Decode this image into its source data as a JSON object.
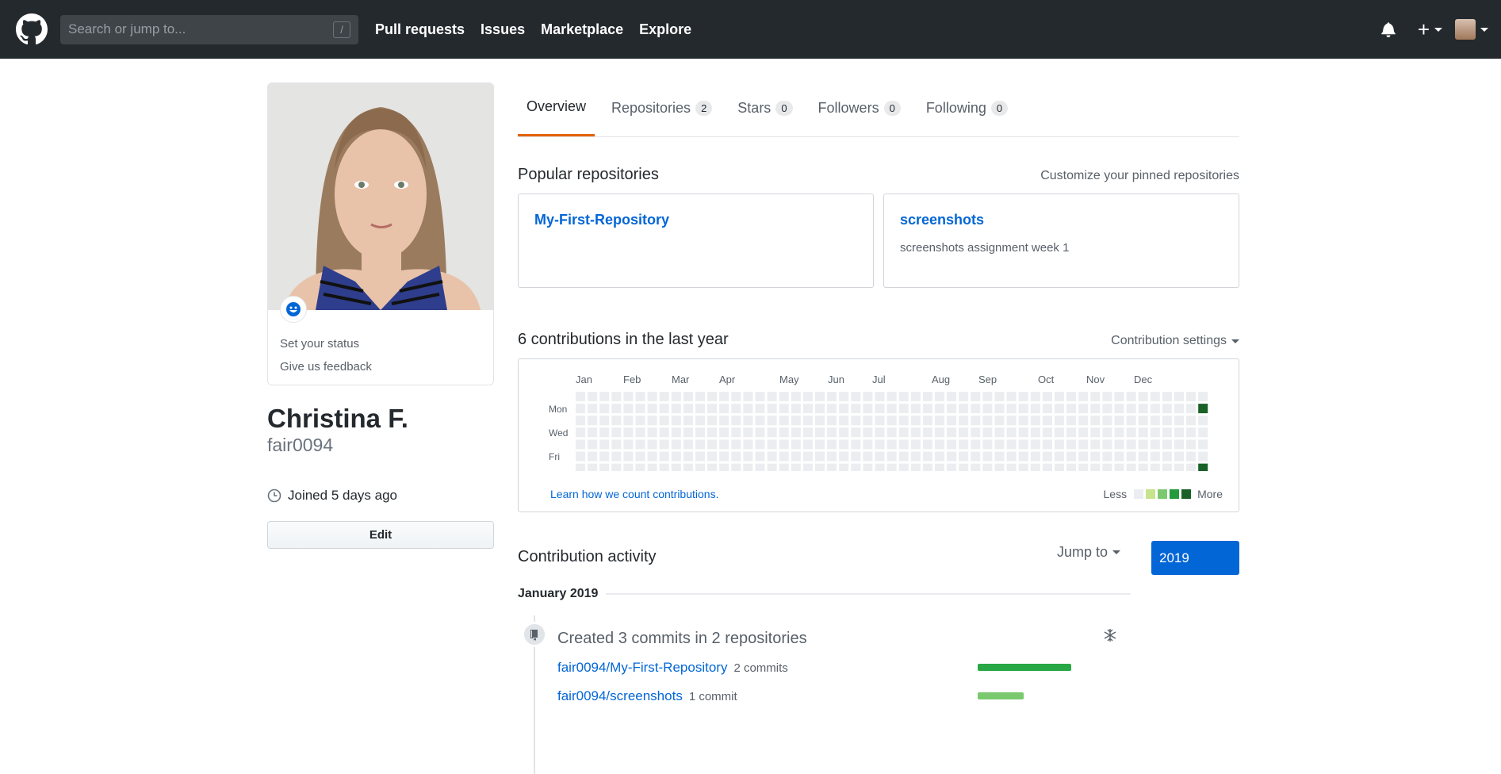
{
  "header": {
    "search_placeholder": "Search or jump to...",
    "search_shortcut": "/",
    "nav": [
      "Pull requests",
      "Issues",
      "Marketplace",
      "Explore"
    ],
    "plus": "+"
  },
  "profile": {
    "status_links": [
      "Set your status",
      "Give us feedback"
    ],
    "fullname": "Christina F.",
    "username": "fair0094",
    "joined": "Joined 5 days ago",
    "edit_label": "Edit"
  },
  "tabs": [
    {
      "label": "Overview",
      "count": null
    },
    {
      "label": "Repositories",
      "count": "2"
    },
    {
      "label": "Stars",
      "count": "0"
    },
    {
      "label": "Followers",
      "count": "0"
    },
    {
      "label": "Following",
      "count": "0"
    }
  ],
  "popular": {
    "title": "Popular repositories",
    "customize": "Customize your pinned repositories",
    "repos": [
      {
        "name": "My-First-Repository",
        "desc": ""
      },
      {
        "name": "screenshots",
        "desc": "screenshots assignment week 1"
      }
    ]
  },
  "contributions": {
    "title": "6 contributions in the last year",
    "settings": "Contribution settings",
    "months": [
      "Jan",
      "Feb",
      "Mar",
      "Apr",
      "May",
      "Jun",
      "Jul",
      "Aug",
      "Sep",
      "Oct",
      "Nov",
      "Dec"
    ],
    "days": [
      "Mon",
      "Wed",
      "Fri"
    ],
    "learn": "Learn how we count contributions.",
    "less": "Less",
    "more": "More",
    "active_cells": [
      {
        "week": 52,
        "day": 1,
        "level": 4
      },
      {
        "week": 52,
        "day": 6,
        "level": 4
      }
    ],
    "colors": [
      "#ebedf0",
      "#c6e48b",
      "#7bc96f",
      "#239a3b",
      "#196127"
    ]
  },
  "activity": {
    "title": "Contribution activity",
    "jump": "Jump to",
    "year": "2019",
    "month": "January 2019",
    "event_title": "Created 3 commits in 2 repositories",
    "repos": [
      {
        "name": "fair0094/My-First-Repository",
        "commits": "2 commits",
        "share": 0.67
      },
      {
        "name": "fair0094/screenshots",
        "commits": "1 commit",
        "share": 0.33
      }
    ]
  }
}
